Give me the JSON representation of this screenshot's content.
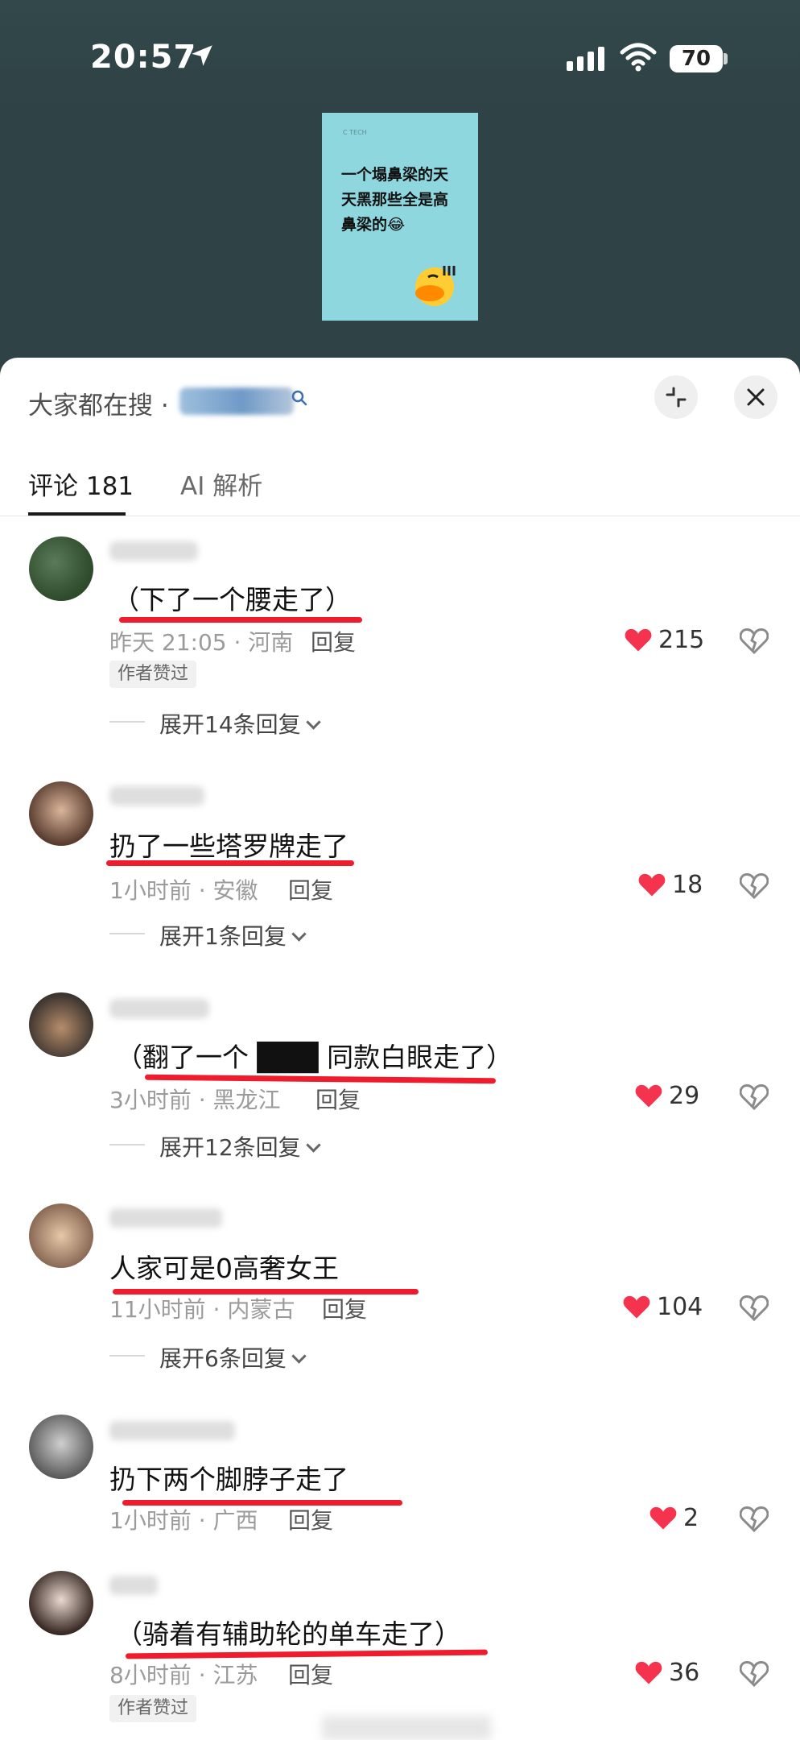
{
  "status_bar": {
    "time": "20:57",
    "battery": "70"
  },
  "video": {
    "thumb_small_text": "C TECH",
    "thumb_text": "一个塌鼻梁的天天黑那些全是高鼻梁的😂"
  },
  "search": {
    "prefix": "大家都在搜 ·"
  },
  "tabs": {
    "comments": "评论 181",
    "ai": "AI 解析"
  },
  "comments": [
    {
      "text": "（下了一个腰走了）",
      "time": "昨天 21:05 · 河南",
      "reply": "回复",
      "likes": "215",
      "badge": "作者赞过",
      "expand": "展开14条回复"
    },
    {
      "text": "扔了一些塔罗牌走了",
      "time": "1小时前 · 安徽",
      "reply": "回复",
      "likes": "18",
      "expand": "展开1条回复"
    },
    {
      "text": "（翻了一个 ███ 同款白眼走了）",
      "time": "3小时前 · 黑龙江",
      "reply": "回复",
      "likes": "29",
      "expand": "展开12条回复"
    },
    {
      "text": "人家可是0高奢女王",
      "time": "11小时前 · 内蒙古",
      "reply": "回复",
      "likes": "104",
      "expand": "展开6条回复"
    },
    {
      "text": "扔下两个脚脖子走了",
      "time": "1小时前 · 广西",
      "reply": "回复",
      "likes": "2"
    },
    {
      "text": "（骑着有辅助轮的单车走了）",
      "time": "8小时前 · 江苏",
      "reply": "回复",
      "likes": "36",
      "badge": "作者赞过"
    }
  ],
  "colors": {
    "accent_red": "#ef1c2d",
    "heart": "#f5334f"
  }
}
